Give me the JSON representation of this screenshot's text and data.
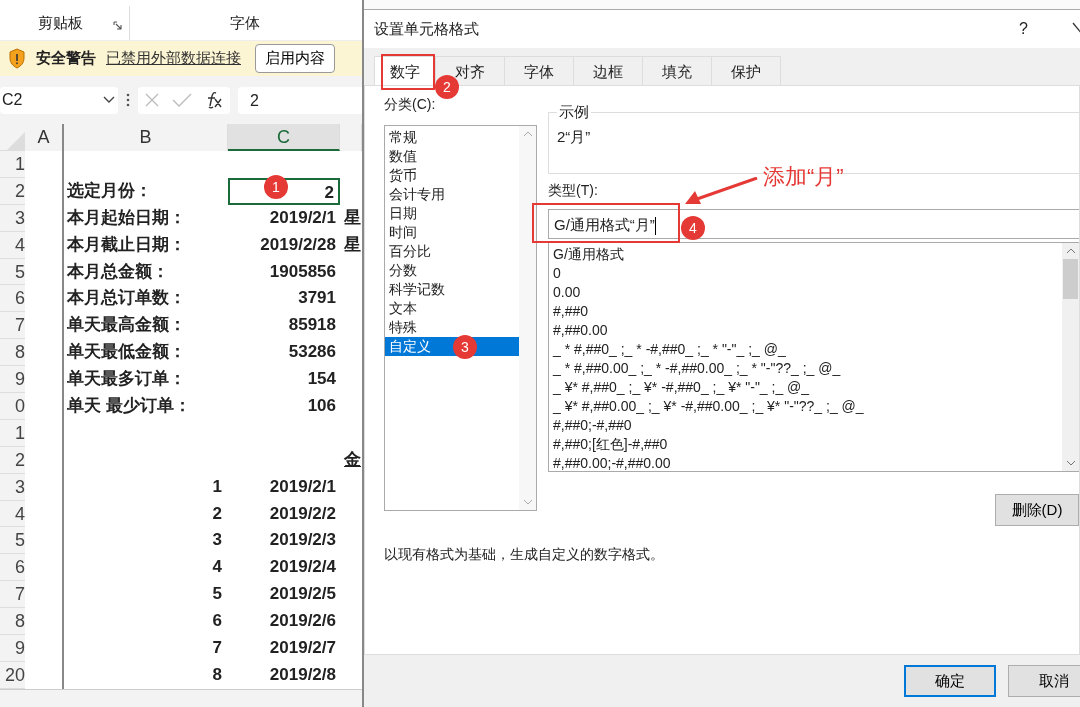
{
  "ribbon": {
    "groups": [
      {
        "label": "剪贴板",
        "launcher": true
      },
      {
        "label": "字体",
        "launcher": false
      }
    ]
  },
  "security_bar": {
    "title": "安全警告",
    "message": "已禁用外部数据连接",
    "button": "启用内容"
  },
  "formula_bar": {
    "name_box": "C2",
    "value": "2"
  },
  "sheet": {
    "columns": [
      {
        "label": "A",
        "selected": false
      },
      {
        "label": "B",
        "selected": false
      },
      {
        "label": "C",
        "selected": true
      }
    ],
    "rows": [
      {
        "number": "1",
        "kind": "blank",
        "label": "",
        "value": "",
        "extra": "",
        "selected": false
      },
      {
        "number": "2",
        "kind": "summary",
        "label": "选定月份：",
        "value": "2",
        "extra": "",
        "selected": true
      },
      {
        "number": "3",
        "kind": "summary",
        "label": "本月起始日期：",
        "value": "2019/2/1",
        "extra": "星",
        "selected": false
      },
      {
        "number": "4",
        "kind": "summary",
        "label": "本月截止日期：",
        "value": "2019/2/28",
        "extra": "星",
        "selected": false
      },
      {
        "number": "5",
        "kind": "summary",
        "label": "本月总金额：",
        "value": "1905856",
        "extra": "",
        "selected": false
      },
      {
        "number": "6",
        "kind": "summary",
        "label": "本月总订单数：",
        "value": "3791",
        "extra": "",
        "selected": false
      },
      {
        "number": "7",
        "kind": "summary",
        "label": "单天最高金额：",
        "value": "85918",
        "extra": "",
        "selected": false
      },
      {
        "number": "8",
        "kind": "summary",
        "label": "单天最低金额：",
        "value": "53286",
        "extra": "",
        "selected": false
      },
      {
        "number": "9",
        "kind": "summary",
        "label": "单天最多订单：",
        "value": "154",
        "extra": "",
        "selected": false
      },
      {
        "number": "0",
        "kind": "summary",
        "label": "单天 最少订单：",
        "value": "106",
        "extra": "",
        "selected": false
      },
      {
        "number": "1",
        "kind": "blank",
        "label": "",
        "value": "",
        "extra": "",
        "selected": false
      },
      {
        "number": "2",
        "kind": "heading",
        "label": "",
        "value": "",
        "extra": "金",
        "selected": false
      },
      {
        "number": "3",
        "kind": "list",
        "label": "1",
        "value": "2019/2/1",
        "extra": "",
        "selected": false
      },
      {
        "number": "4",
        "kind": "list",
        "label": "2",
        "value": "2019/2/2",
        "extra": "",
        "selected": false
      },
      {
        "number": "5",
        "kind": "list",
        "label": "3",
        "value": "2019/2/3",
        "extra": "",
        "selected": false
      },
      {
        "number": "6",
        "kind": "list",
        "label": "4",
        "value": "2019/2/4",
        "extra": "",
        "selected": false
      },
      {
        "number": "7",
        "kind": "list",
        "label": "5",
        "value": "2019/2/5",
        "extra": "",
        "selected": false
      },
      {
        "number": "8",
        "kind": "list",
        "label": "6",
        "value": "2019/2/6",
        "extra": "",
        "selected": false
      },
      {
        "number": "9",
        "kind": "list",
        "label": "7",
        "value": "2019/2/7",
        "extra": "",
        "selected": false
      },
      {
        "number": "20",
        "kind": "list",
        "label": "8",
        "value": "2019/2/8",
        "extra": "",
        "selected": false
      }
    ]
  },
  "dialog": {
    "title": "设置单元格格式",
    "help": "?",
    "tabs": [
      {
        "label": "数字",
        "selected": true
      },
      {
        "label": "对齐",
        "selected": false
      },
      {
        "label": "字体",
        "selected": false
      },
      {
        "label": "边框",
        "selected": false
      },
      {
        "label": "填充",
        "selected": false
      },
      {
        "label": "保护",
        "selected": false
      }
    ],
    "category_label": "分类(C):",
    "categories": [
      {
        "label": "常规",
        "selected": false
      },
      {
        "label": "数值",
        "selected": false
      },
      {
        "label": "货币",
        "selected": false
      },
      {
        "label": "会计专用",
        "selected": false
      },
      {
        "label": "日期",
        "selected": false
      },
      {
        "label": "时间",
        "selected": false
      },
      {
        "label": "百分比",
        "selected": false
      },
      {
        "label": "分数",
        "selected": false
      },
      {
        "label": "科学记数",
        "selected": false
      },
      {
        "label": "文本",
        "selected": false
      },
      {
        "label": "特殊",
        "selected": false
      },
      {
        "label": "自定义",
        "selected": true
      }
    ],
    "sample": {
      "label": "示例",
      "value": "2“月”"
    },
    "type_label": "类型(T):",
    "type_field": {
      "value": "G/通用格式“月”"
    },
    "formats": [
      "G/通用格式",
      "0",
      "0.00",
      "#,##0",
      "#,##0.00",
      "_ * #,##0_ ;_ * -#,##0_ ;_ * \"-\"_ ;_ @_",
      "_ * #,##0.00_ ;_ * -#,##0.00_ ;_ * \"-\"??_ ;_ @_",
      "_ ¥* #,##0_ ;_ ¥* -#,##0_ ;_ ¥* \"-\"_ ;_ @_",
      "_ ¥* #,##0.00_ ;_ ¥* -#,##0.00_ ;_ ¥* \"-\"??_ ;_ @_",
      "#,##0;-#,##0",
      "#,##0;[红色]-#,##0",
      "#,##0.00;-#,##0.00"
    ],
    "delete_button": "删除(D)",
    "description": "以现有格式为基础，生成自定义的数字格式。",
    "buttons": [
      {
        "label": "确定",
        "kind": "primary"
      },
      {
        "label": "取消",
        "kind": "default"
      }
    ]
  },
  "annotations": {
    "badges": [
      "1",
      "2",
      "3",
      "4"
    ],
    "callout": "添加“月”"
  }
}
